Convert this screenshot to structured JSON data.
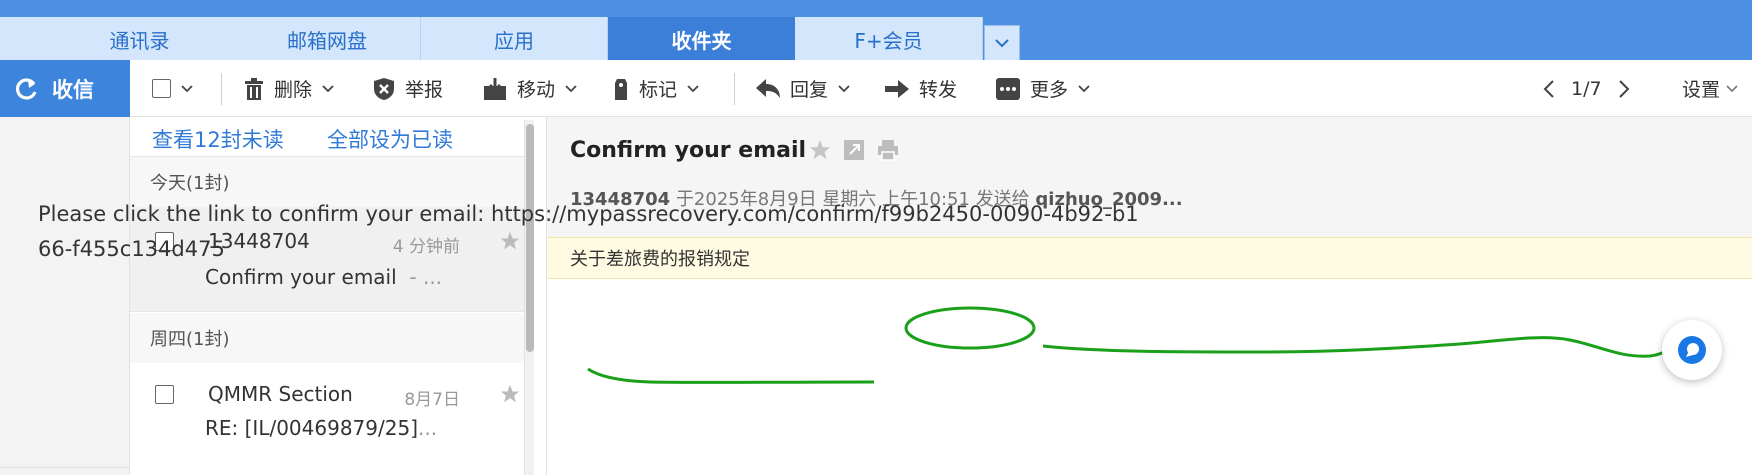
{
  "tabs": [
    {
      "label": "通讯录",
      "active": false
    },
    {
      "label": "邮箱网盘",
      "active": false
    },
    {
      "label": "应用",
      "active": false
    },
    {
      "label": "收件夹",
      "active": true
    },
    {
      "label": "F+会员",
      "active": false
    }
  ],
  "toolbar": {
    "receive": "收信",
    "delete": "删除",
    "report": "举报",
    "move": "移动",
    "mark": "标记",
    "reply": "回复",
    "forward": "转发",
    "more": "更多",
    "page": "1/7",
    "settings": "设置"
  },
  "list": {
    "view_unread": "查看12封未读",
    "mark_all_read": "全部设为已读",
    "groups": [
      {
        "label": "今天(1封)",
        "mails": [
          {
            "from": "13448704",
            "time": "4 分钟前",
            "subject": "Confirm your email",
            "snippet": "- ...",
            "selected": true
          }
        ]
      },
      {
        "label": "周四(1封)",
        "mails": [
          {
            "from": "QMMR Section",
            "time": "8月7日",
            "subject": "RE: [IL/00469879/25]",
            "snippet": "...",
            "selected": false
          }
        ]
      }
    ]
  },
  "reader": {
    "subject": "Confirm your email",
    "sender": "13448704",
    "date_text": "于2025年8月9日 星期六 上午10:51 发送给",
    "recipient": "qizhuo_2009...",
    "notice": "关于差旅费的报销规定",
    "body_prefix": "Please click the link to confirm your email: ",
    "body_link": "https://mypassrecovery.com/confirm/f99b2450-0090-4b92-b166-f455c134d475"
  },
  "colors": {
    "topbar": "#4d8fe0",
    "tab_bg": "#d3e6fb",
    "tab_active": "#3c7fd9",
    "link": "#2f7ad8",
    "annotation": "#1aa01a",
    "notice_bg": "#fffbe3"
  },
  "icons": [
    "refresh-icon",
    "trash-icon",
    "shield-icon",
    "move-icon",
    "tag-icon",
    "reply-icon",
    "forward-icon",
    "more-icon",
    "star-icon",
    "popout-icon",
    "print-icon",
    "chat-fab-icon"
  ]
}
